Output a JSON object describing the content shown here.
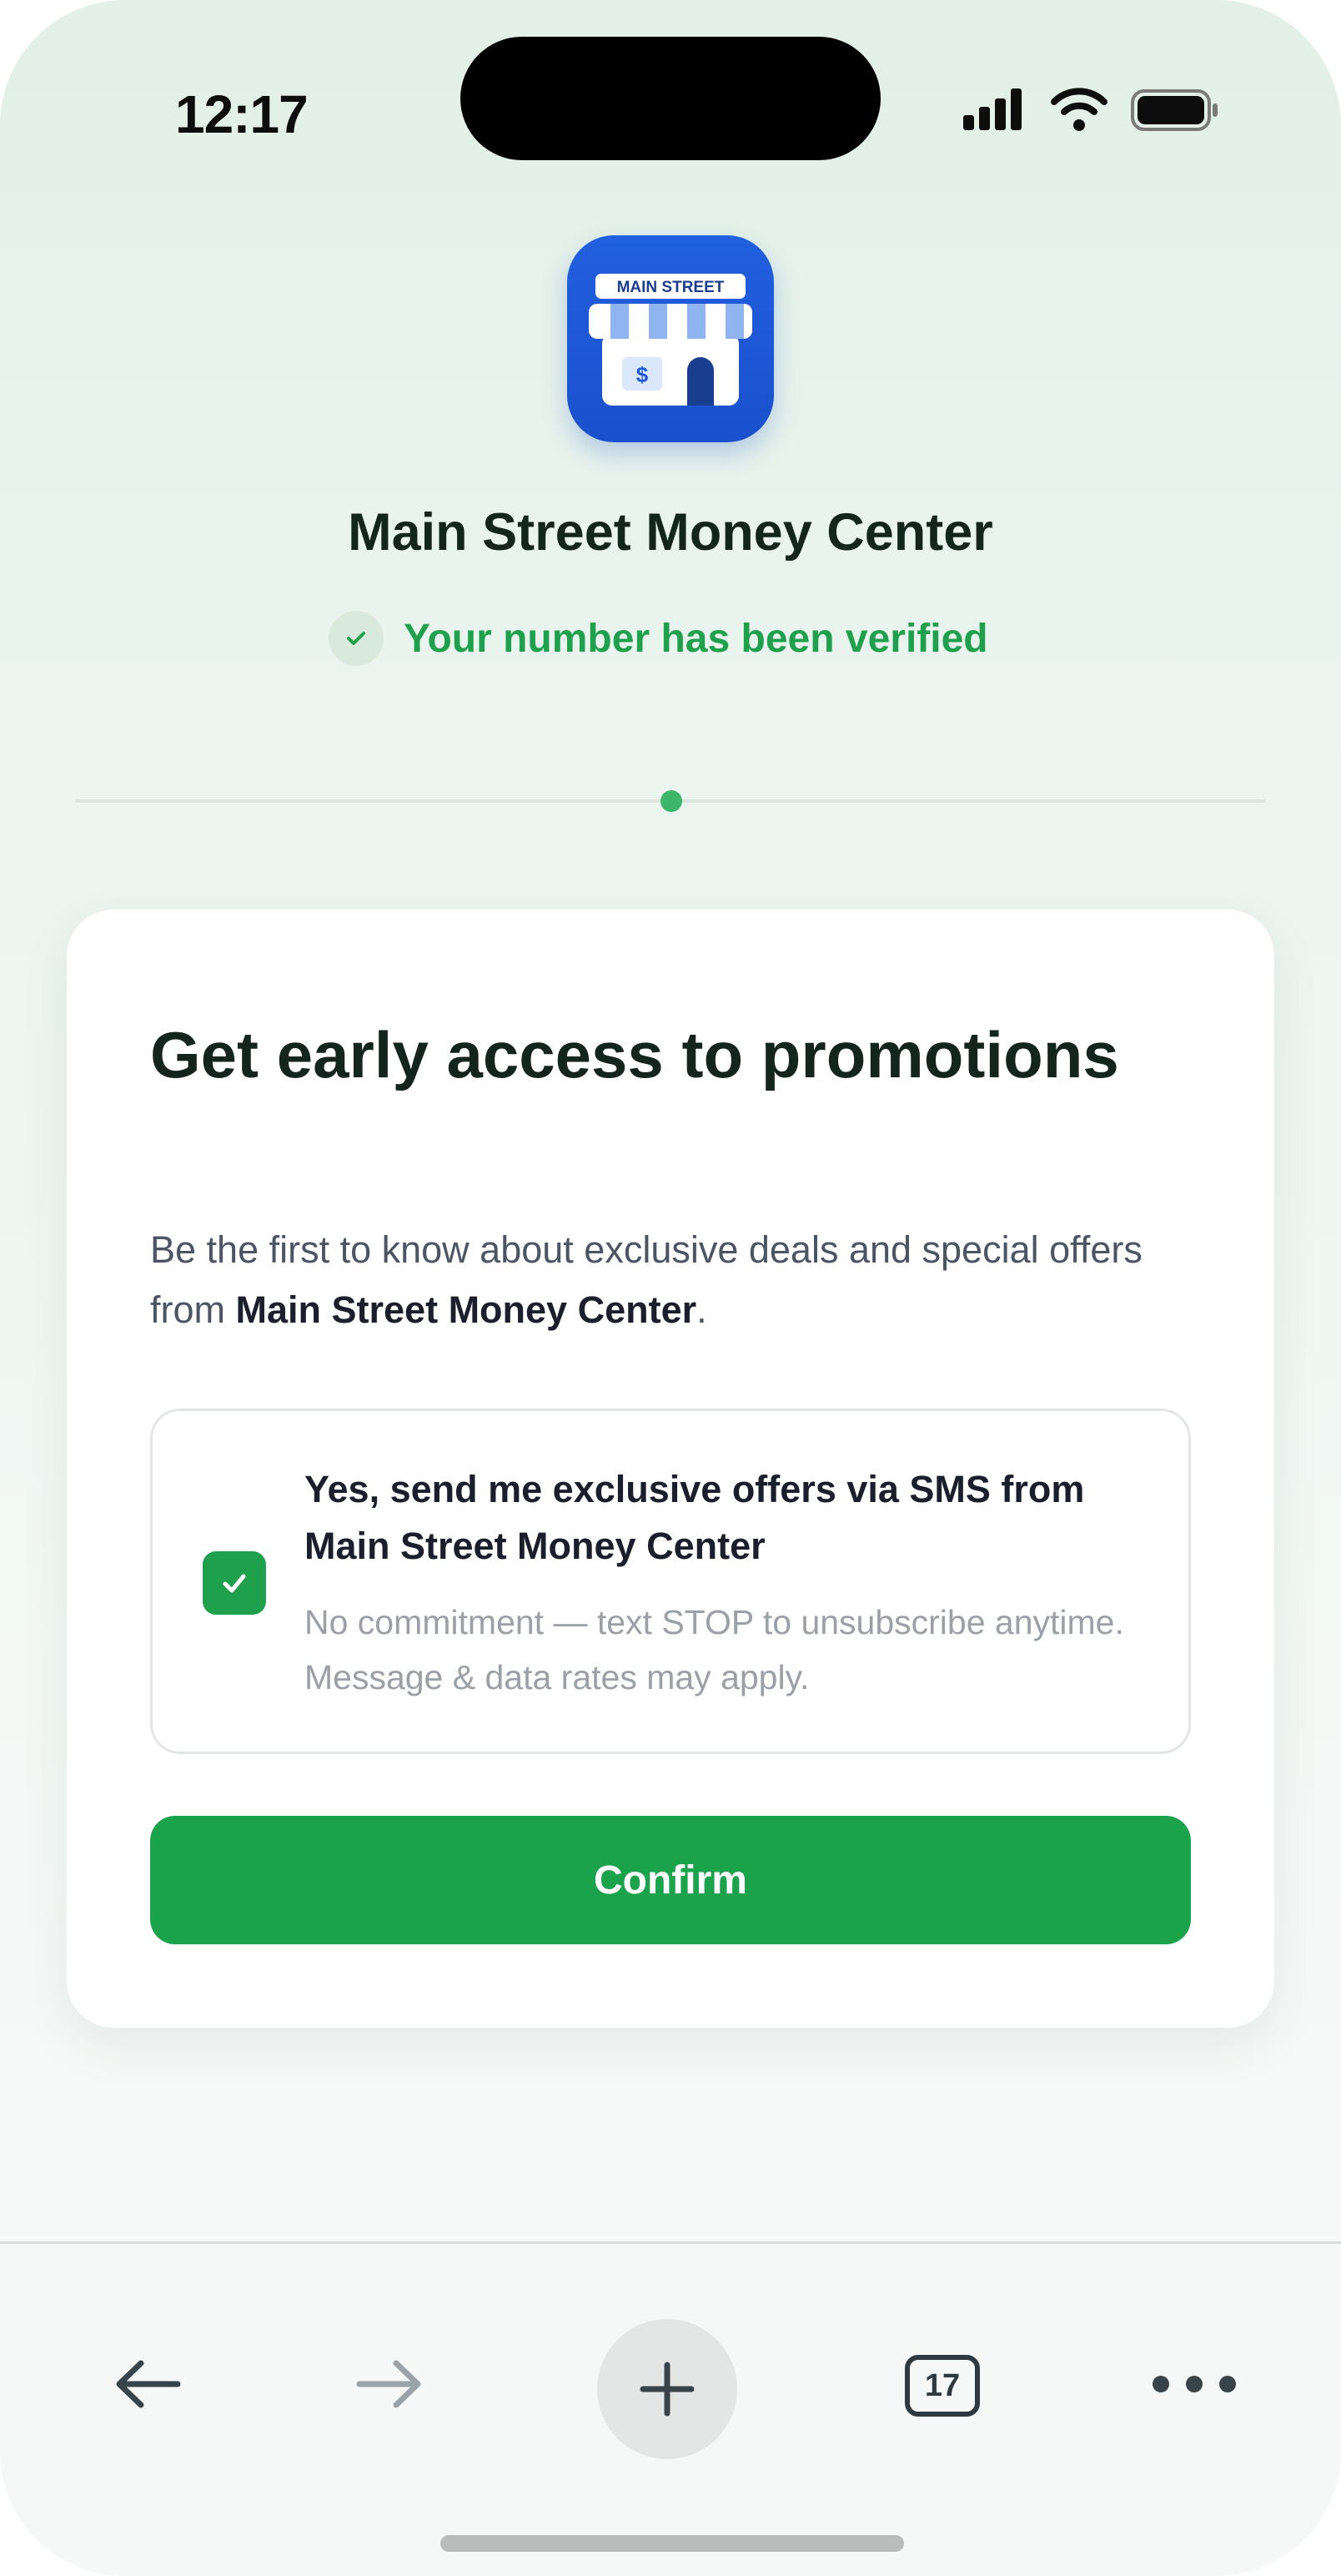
{
  "status_bar": {
    "time": "12:17",
    "icons": [
      "cellular-signal-icon",
      "wifi-icon",
      "battery-icon"
    ]
  },
  "header": {
    "app_icon": {
      "name": "main-street-storefront-icon",
      "sign_text": "MAIN STREET",
      "symbol": "$",
      "background": "#1a56db"
    },
    "app_name": "Main Street Money Center",
    "verified_text": "Your number has been verified",
    "verified_color": "#1ea04d"
  },
  "progress": {
    "steps": 1,
    "current": 1
  },
  "card": {
    "title": "Get early access to promotions",
    "description_before": "Be the first to know about exclusive deals and special offers from ",
    "description_brand": "Main Street Money Center",
    "description_after": ".",
    "optin": {
      "checked": true,
      "label": "Yes, send me exclusive offers via SMS from Main Street Money Center",
      "note": "No commitment — text STOP to unsubscribe anytime. Message & data rates may apply."
    },
    "confirm_label": "Confirm",
    "accent_color": "#1ba34c"
  },
  "toolbar": {
    "back_icon": "arrow-left-icon",
    "forward_icon": "arrow-right-icon",
    "new_tab_icon": "plus-icon",
    "tab_count": "17",
    "more_icon": "ellipsis-icon"
  }
}
